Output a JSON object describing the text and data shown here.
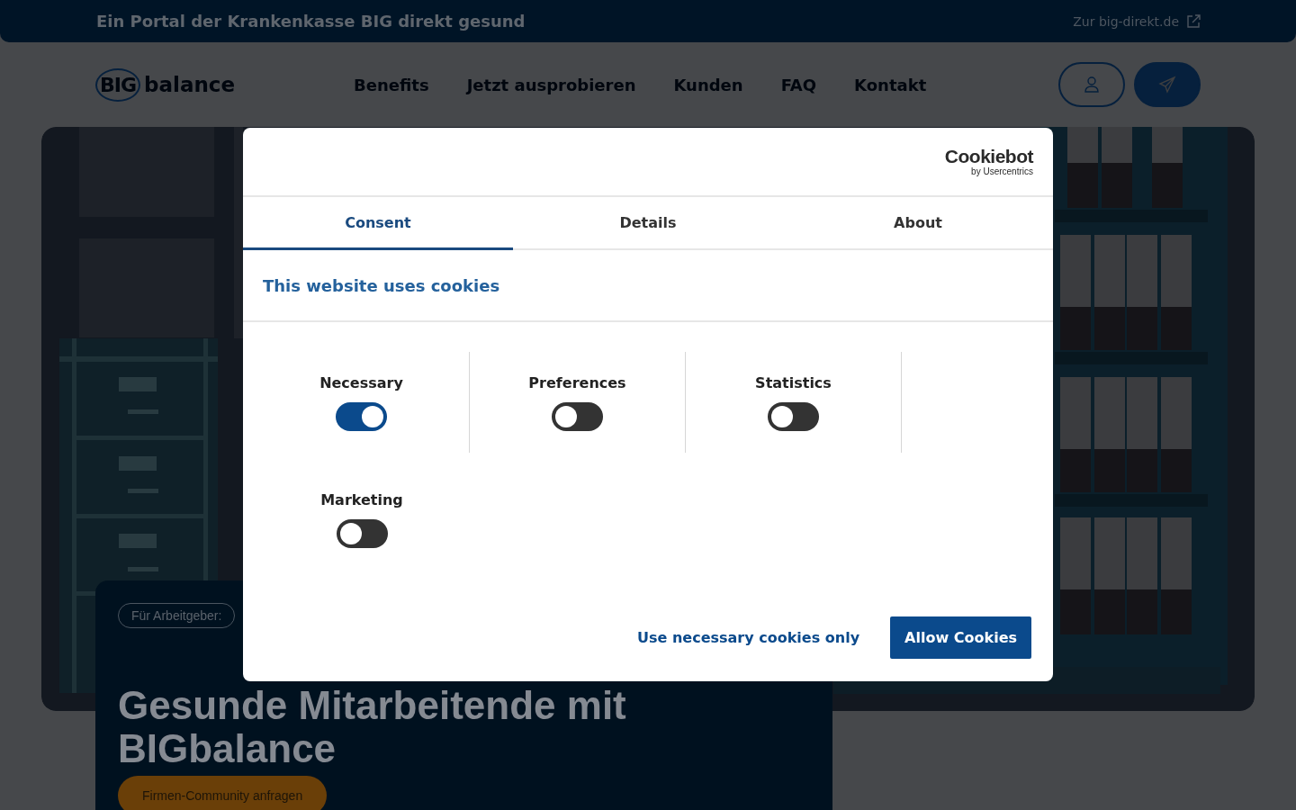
{
  "top_bar": {
    "tagline": "Ein Portal der Krankenkasse BIG direkt gesund",
    "link": "Zur big-direkt.de"
  },
  "header": {
    "logo_mark": "BIG",
    "logo_text": "balance",
    "nav": [
      "Benefits",
      "Jetzt ausprobieren",
      "Kunden",
      "FAQ",
      "Kontakt"
    ]
  },
  "hero": {
    "badge": "Für Arbeitgeber:",
    "headline": "Gesunde Mitarbeitende mit BIGbalance",
    "cta": "Firmen-Community anfragen"
  },
  "cookie_dialog": {
    "brand": "Cookiebot",
    "brand_sub": "by Usercentrics",
    "tabs": [
      {
        "label": "Consent",
        "selected": true
      },
      {
        "label": "Details",
        "selected": false
      },
      {
        "label": "About",
        "selected": false
      }
    ],
    "title": "This website uses cookies",
    "categories": [
      {
        "label": "Necessary",
        "checked": true
      },
      {
        "label": "Preferences",
        "checked": false
      },
      {
        "label": "Statistics",
        "checked": false
      },
      {
        "label": "Marketing",
        "checked": false
      }
    ],
    "buttons": [
      {
        "label": "Use necessary cookies only",
        "kind": "link"
      },
      {
        "label": "Allow Cookies",
        "kind": "primary"
      }
    ]
  }
}
